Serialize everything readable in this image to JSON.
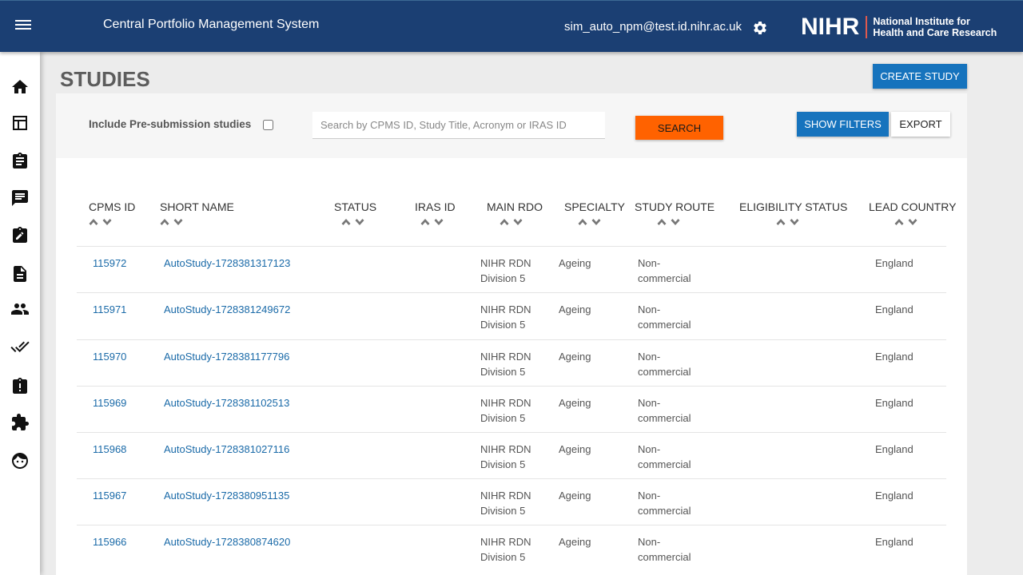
{
  "header": {
    "app_title": "Central Portfolio Management System",
    "user_email": "sim_auto_npm@test.id.nihr.ac.uk",
    "brand_mark": "NIHR",
    "brand_name_line1": "National Institute for",
    "brand_name_line2": "Health and Care Research",
    "menu_icon": "hamburger-menu-icon",
    "settings_icon": "gear-icon"
  },
  "sidebar": {
    "items": [
      {
        "icon": "home-icon"
      },
      {
        "icon": "dashboard-icon"
      },
      {
        "icon": "assignment-icon"
      },
      {
        "icon": "feedback-icon"
      },
      {
        "icon": "edit-assignment-icon"
      },
      {
        "icon": "document-icon"
      },
      {
        "icon": "people-icon"
      },
      {
        "icon": "done-all-icon"
      },
      {
        "icon": "assignment-late-icon"
      },
      {
        "icon": "extension-icon"
      },
      {
        "icon": "face-icon"
      }
    ]
  },
  "page": {
    "title": "STUDIES",
    "create_label": "CREATE STUDY"
  },
  "filters": {
    "presub_label": "Include Pre-submission studies",
    "presub_checked": false,
    "search_placeholder": "Search by CPMS ID, Study Title, Acronym or IRAS ID",
    "search_value": "",
    "search_label": "SEARCH",
    "show_filters_label": "SHOW FILTERS",
    "export_label": "EXPORT"
  },
  "colors": {
    "header_bg": "#1b3f73",
    "primary_button": "#1673bd",
    "search_button": "#ff6200",
    "link": "#1a6aa8",
    "brand_accent": "#e0594e"
  },
  "table": {
    "columns": [
      "CPMS ID",
      "SHORT NAME",
      "STATUS",
      "IRAS ID",
      "MAIN RDO",
      "SPECIALTY",
      "STUDY ROUTE",
      "ELIGIBILITY STATUS",
      "LEAD COUNTRY"
    ],
    "rows": [
      {
        "cpms_id": "115972",
        "short_name": "AutoStudy-1728381317123",
        "status": "",
        "iras_id": "",
        "rdo1": "NIHR RDN",
        "rdo2": "Division 5",
        "specialty": "Ageing",
        "route1": "Non-",
        "route2": "commercial",
        "eligibility": "",
        "country": "England"
      },
      {
        "cpms_id": "115971",
        "short_name": "AutoStudy-1728381249672",
        "status": "",
        "iras_id": "",
        "rdo1": "NIHR RDN",
        "rdo2": "Division 5",
        "specialty": "Ageing",
        "route1": "Non-",
        "route2": "commercial",
        "eligibility": "",
        "country": "England"
      },
      {
        "cpms_id": "115970",
        "short_name": "AutoStudy-1728381177796",
        "status": "",
        "iras_id": "",
        "rdo1": "NIHR RDN",
        "rdo2": "Division 5",
        "specialty": "Ageing",
        "route1": "Non-",
        "route2": "commercial",
        "eligibility": "",
        "country": "England"
      },
      {
        "cpms_id": "115969",
        "short_name": "AutoStudy-1728381102513",
        "status": "",
        "iras_id": "",
        "rdo1": "NIHR RDN",
        "rdo2": "Division 5",
        "specialty": "Ageing",
        "route1": "Non-",
        "route2": "commercial",
        "eligibility": "",
        "country": "England"
      },
      {
        "cpms_id": "115968",
        "short_name": "AutoStudy-1728381027116",
        "status": "",
        "iras_id": "",
        "rdo1": "NIHR RDN",
        "rdo2": "Division 5",
        "specialty": "Ageing",
        "route1": "Non-",
        "route2": "commercial",
        "eligibility": "",
        "country": "England"
      },
      {
        "cpms_id": "115967",
        "short_name": "AutoStudy-1728380951135",
        "status": "",
        "iras_id": "",
        "rdo1": "NIHR RDN",
        "rdo2": "Division 5",
        "specialty": "Ageing",
        "route1": "Non-",
        "route2": "commercial",
        "eligibility": "",
        "country": "England"
      },
      {
        "cpms_id": "115966",
        "short_name": "AutoStudy-1728380874620",
        "status": "",
        "iras_id": "",
        "rdo1": "NIHR RDN",
        "rdo2": "Division 5",
        "specialty": "Ageing",
        "route1": "Non-",
        "route2": "commercial",
        "eligibility": "",
        "country": "England"
      }
    ]
  }
}
